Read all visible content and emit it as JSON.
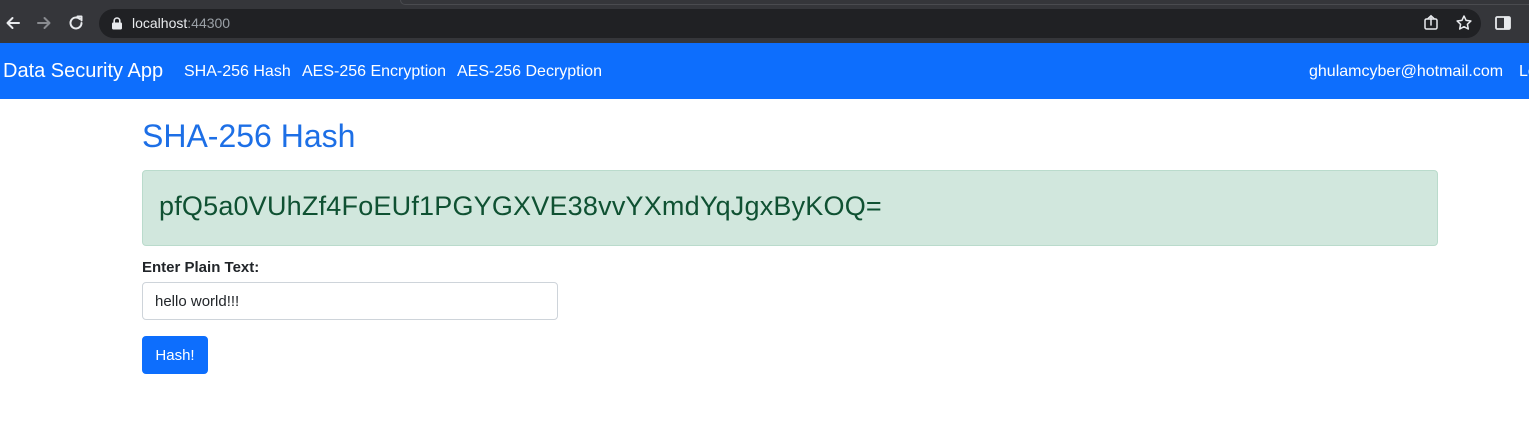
{
  "browser": {
    "url_host": "localhost",
    "url_port": ":44300"
  },
  "navbar": {
    "brand": "Data Security App",
    "links": [
      {
        "label": "SHA-256 Hash"
      },
      {
        "label": "AES-256 Encryption"
      },
      {
        "label": "AES-256 Decryption"
      }
    ],
    "user_email": "ghulamcyber@hotmail.com",
    "logout_partial": "Lo"
  },
  "main": {
    "title": "SHA-256 Hash",
    "result_hash": "pfQ5a0VUhZf4FoEUf1PGYGXVE38vvYXmdYqJgxByKOQ=",
    "input_label": "Enter Plain Text:",
    "input_value": "hello world!!!",
    "submit_label": "Hash!"
  },
  "colors": {
    "navbar_bg": "#0d6efd",
    "alert_bg": "#d1e7dd",
    "alert_text": "#0f5132",
    "title": "#1d6fe6"
  }
}
